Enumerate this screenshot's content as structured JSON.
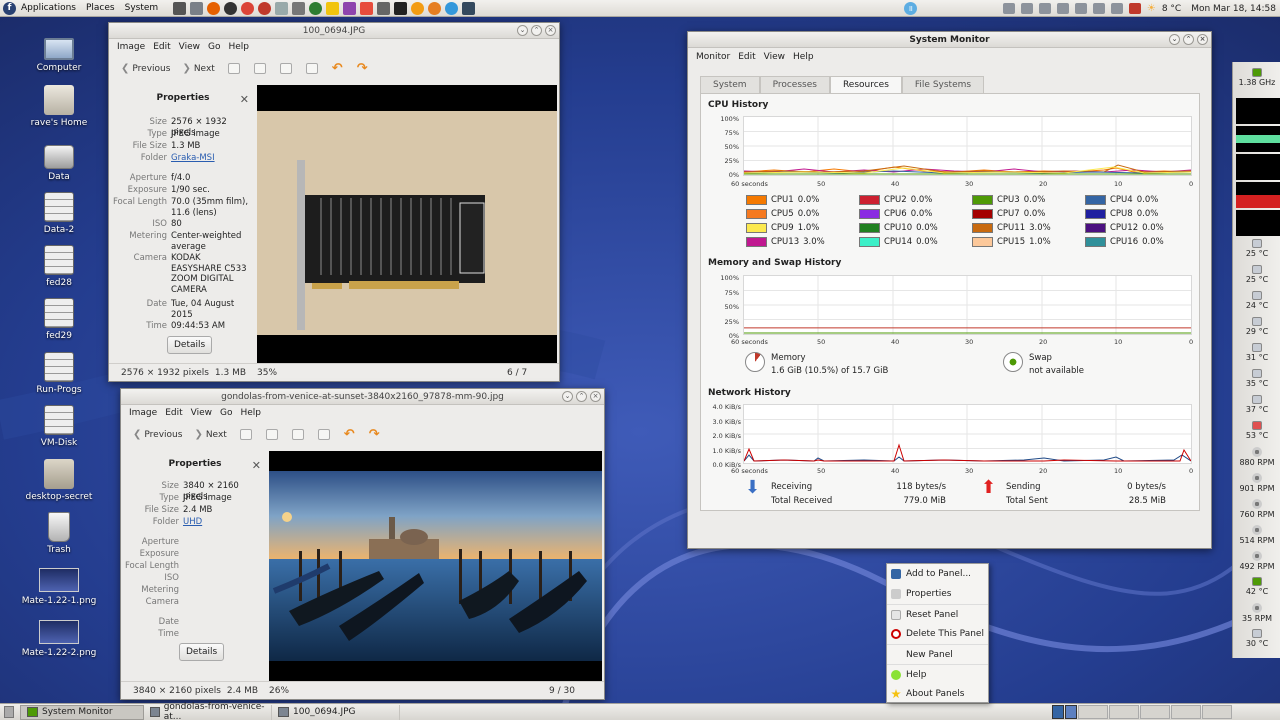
{
  "top_panel": {
    "menus": [
      "Applications",
      "Places",
      "System"
    ],
    "launchers": [
      "terminal-icon",
      "files-icon",
      "firefox-icon",
      "github-icon",
      "chrome-icon",
      "game-icon",
      "tools-icon",
      "clock-icon",
      "edit-icon",
      "music-icon",
      "mail-icon",
      "media-icon",
      "vm-icon",
      "console-icon",
      "fish-icon",
      "fish2-icon",
      "globe-icon",
      "monitor-icon"
    ],
    "weather": "8 °C",
    "datetime": "Mon Mar 18, 14:58"
  },
  "desktop_icons": [
    {
      "label": "Computer",
      "icon": "computer-icon"
    },
    {
      "label": "rave's Home",
      "icon": "home-folder-icon"
    },
    {
      "label": "Data",
      "icon": "disk-icon"
    },
    {
      "label": "Data-2",
      "icon": "drive-icon"
    },
    {
      "label": "fed28",
      "icon": "drive-icon"
    },
    {
      "label": "fed29",
      "icon": "drive-icon"
    },
    {
      "label": "Run-Progs",
      "icon": "drive-icon"
    },
    {
      "label": "VM-Disk",
      "icon": "drive-icon"
    },
    {
      "label": "desktop-secret",
      "icon": "folder-icon"
    },
    {
      "label": "Trash",
      "icon": "trash-icon"
    },
    {
      "label": "Mate-1.22-1.png",
      "icon": "image-file-icon"
    },
    {
      "label": "Mate-1.22-2.png",
      "icon": "image-file-icon"
    }
  ],
  "eom1": {
    "title": "100_0694.JPG",
    "menus": [
      "Image",
      "Edit",
      "View",
      "Go",
      "Help"
    ],
    "prev": "Previous",
    "next": "Next",
    "props_title": "Properties",
    "props": [
      {
        "k": "Size",
        "v": "2576 × 1932 pixels"
      },
      {
        "k": "Type",
        "v": "JPEG image"
      },
      {
        "k": "File Size",
        "v": "1.3 MB"
      },
      {
        "k": "Folder",
        "v": "Graka-MSI",
        "link": true
      },
      {
        "k": "Aperture",
        "v": "f/4.0"
      },
      {
        "k": "Exposure",
        "v": "1/90 sec."
      },
      {
        "k": "Focal Length",
        "v": "70.0 (35mm film), 11.6 (lens)"
      },
      {
        "k": "ISO",
        "v": "80"
      },
      {
        "k": "Metering",
        "v": "Center-weighted average"
      },
      {
        "k": "Camera",
        "v": "KODAK EASYSHARE C533 ZOOM DIGITAL CAMERA"
      },
      {
        "k": "Date",
        "v": "Tue, 04 August 2015"
      },
      {
        "k": "Time",
        "v": "09:44:53 AM"
      }
    ],
    "details": "Details",
    "status_dims": "2576 × 1932 pixels",
    "status_size": "1.3 MB",
    "status_zoom": "35%",
    "status_pos": "6 / 7"
  },
  "eom2": {
    "title": "gondolas-from-venice-at-sunset-3840x2160_97878-mm-90.jpg",
    "menus": [
      "Image",
      "Edit",
      "View",
      "Go",
      "Help"
    ],
    "prev": "Previous",
    "next": "Next",
    "props_title": "Properties",
    "props": [
      {
        "k": "Size",
        "v": "3840 × 2160 pixels"
      },
      {
        "k": "Type",
        "v": "JPEG image"
      },
      {
        "k": "File Size",
        "v": "2.4 MB"
      },
      {
        "k": "Folder",
        "v": "UHD",
        "link": true
      },
      {
        "k": "Aperture",
        "v": ""
      },
      {
        "k": "Exposure",
        "v": ""
      },
      {
        "k": "Focal Length",
        "v": ""
      },
      {
        "k": "ISO",
        "v": ""
      },
      {
        "k": "Metering",
        "v": ""
      },
      {
        "k": "Camera",
        "v": ""
      },
      {
        "k": "Date",
        "v": ""
      },
      {
        "k": "Time",
        "v": ""
      }
    ],
    "details": "Details",
    "status_dims": "3840 × 2160 pixels",
    "status_size": "2.4 MB",
    "status_zoom": "26%",
    "status_pos": "9 / 30"
  },
  "sysmon": {
    "title": "System Monitor",
    "menus": [
      "Monitor",
      "Edit",
      "View",
      "Help"
    ],
    "tabs": [
      "System",
      "Processes",
      "Resources",
      "File Systems"
    ],
    "active_tab": "Resources",
    "cpu_title": "CPU History",
    "mem_title": "Memory and Swap History",
    "net_title": "Network History",
    "pct_ticks": [
      "100%",
      "75%",
      "50%",
      "25%",
      "0%"
    ],
    "net_ticks": [
      "4.0 KiB/s",
      "3.0 KiB/s",
      "2.0 KiB/s",
      "1.0 KiB/s",
      "0.0 KiB/s"
    ],
    "x_ticks": [
      "60 seconds",
      "50",
      "40",
      "30",
      "20",
      "10",
      "0"
    ],
    "cpus": [
      {
        "label": "CPU1",
        "value": "0.0%",
        "color": "#f57900"
      },
      {
        "label": "CPU2",
        "value": "0.0%",
        "color": "#cc2030"
      },
      {
        "label": "CPU3",
        "value": "0.0%",
        "color": "#4e9a06"
      },
      {
        "label": "CPU4",
        "value": "0.0%",
        "color": "#3465a4"
      },
      {
        "label": "CPU5",
        "value": "0.0%",
        "color": "#f57920"
      },
      {
        "label": "CPU6",
        "value": "0.0%",
        "color": "#8a2be2"
      },
      {
        "label": "CPU7",
        "value": "0.0%",
        "color": "#a40000"
      },
      {
        "label": "CPU8",
        "value": "0.0%",
        "color": "#1f1fa0"
      },
      {
        "label": "CPU9",
        "value": "1.0%",
        "color": "#fce94f"
      },
      {
        "label": "CPU10",
        "value": "0.0%",
        "color": "#208020"
      },
      {
        "label": "CPU11",
        "value": "3.0%",
        "color": "#c86a10"
      },
      {
        "label": "CPU12",
        "value": "0.0%",
        "color": "#4b1080"
      },
      {
        "label": "CPU13",
        "value": "3.0%",
        "color": "#c01890"
      },
      {
        "label": "CPU14",
        "value": "0.0%",
        "color": "#3cf0c8"
      },
      {
        "label": "CPU15",
        "value": "1.0%",
        "color": "#fcc89a"
      },
      {
        "label": "CPU16",
        "value": "0.0%",
        "color": "#30909a"
      }
    ],
    "memory_label": "Memory",
    "memory_value": "1.6 GiB (10.5%) of 15.7 GiB",
    "swap_label": "Swap",
    "swap_value": "not available",
    "recv_label": "Receiving",
    "recv_rate": "118 bytes/s",
    "total_recv_label": "Total Received",
    "total_recv": "779.0 MiB",
    "send_label": "Sending",
    "send_rate": "0 bytes/s",
    "total_sent_label": "Total Sent",
    "total_sent": "28.5 MiB",
    "colors": {
      "memory": "#c0392b",
      "swap": "#4e9a06",
      "receive": "#204a87",
      "send": "#cc0000"
    }
  },
  "context_menu": [
    {
      "label": "Add to Panel...",
      "icon": "add-icon"
    },
    {
      "label": "Properties",
      "icon": "properties-icon"
    },
    {
      "label": "Reset Panel",
      "icon": "reset-icon"
    },
    {
      "label": "Delete This Panel",
      "icon": "delete-icon"
    },
    {
      "label": "New Panel",
      "icon": "new-panel-icon"
    },
    {
      "label": "Help",
      "icon": "help-icon"
    },
    {
      "label": "About Panels",
      "icon": "about-icon"
    }
  ],
  "right_panel": {
    "cpu_freq": "1.38 GHz",
    "temps": [
      "25 °C",
      "25 °C",
      "24 °C",
      "29 °C",
      "31 °C",
      "35 °C",
      "37 °C",
      "53 °C"
    ],
    "fans": [
      "880 RPM",
      "901 RPM",
      "760 RPM",
      "514 RPM",
      "492 RPM"
    ],
    "temp_bottom": [
      "42 °C",
      "35 RPM",
      "30 °C"
    ]
  },
  "taskbar": [
    {
      "label": "System Monitor",
      "active": true
    },
    {
      "label": "gondolas-from-venice-at...",
      "active": false
    },
    {
      "label": "100_0694.JPG",
      "active": false
    }
  ]
}
